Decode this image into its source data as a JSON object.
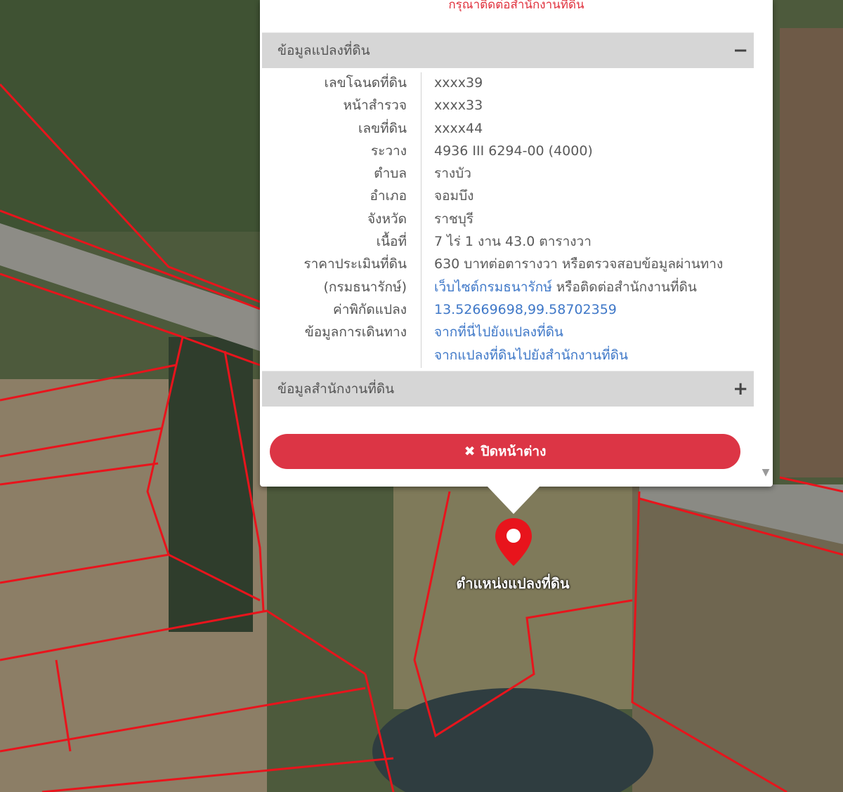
{
  "notice": "กรุณาติดต่อสำนักงานที่ดิน",
  "parcel_section": {
    "title": "ข้อมูลแปลงที่ดิน",
    "toggle": "−",
    "rows": [
      {
        "label": "เลขโฉนดที่ดิน",
        "value": "xxxx39"
      },
      {
        "label": "หน้าสำรวจ",
        "value": "xxxx33"
      },
      {
        "label": "เลขที่ดิน",
        "value": "xxxx44"
      },
      {
        "label": "ระวาง",
        "value": "4936 III 6294-00 (4000)"
      },
      {
        "label": "ตำบล",
        "value": "รางบัว"
      },
      {
        "label": "อำเภอ",
        "value": "จอมบึง"
      },
      {
        "label": "จังหวัด",
        "value": "ราชบุรี"
      },
      {
        "label": "เนื้อที่",
        "value": "7 ไร่ 1 งาน 43.0 ตารางวา"
      }
    ],
    "price": {
      "label_line1": "ราคาประเมินที่ดิน",
      "label_line2": "(กรมธนารักษ์)",
      "value_text": "630 บาทต่อตารางวา หรือตรวจสอบข้อมูลผ่านทาง ",
      "value_link": "เว็บไซต์กรมธนารักษ์",
      "value_after": " หรือติดต่อสำนักงานที่ดิน"
    },
    "coords": {
      "label": "ค่าพิกัดแปลง",
      "value": "13.52669698,99.58702359"
    },
    "directions": {
      "label": "ข้อมูลการเดินทาง",
      "link1": "จากที่นี่ไปยังแปลงที่ดิน",
      "link2": "จากแปลงที่ดินไปยังสำนักงานที่ดิน"
    }
  },
  "office_section": {
    "title": "ข้อมูลสำนักงานที่ดิน",
    "toggle": "+"
  },
  "close_button": {
    "icon": "✖",
    "label": "ปิดหน้าต่าง"
  },
  "scroll_arrow": "▼",
  "map": {
    "marker_label": "ตำแหน่งแปลงที่ดิน",
    "parcel_line_color": "#e8141c",
    "marker_color": "#e8141c"
  }
}
